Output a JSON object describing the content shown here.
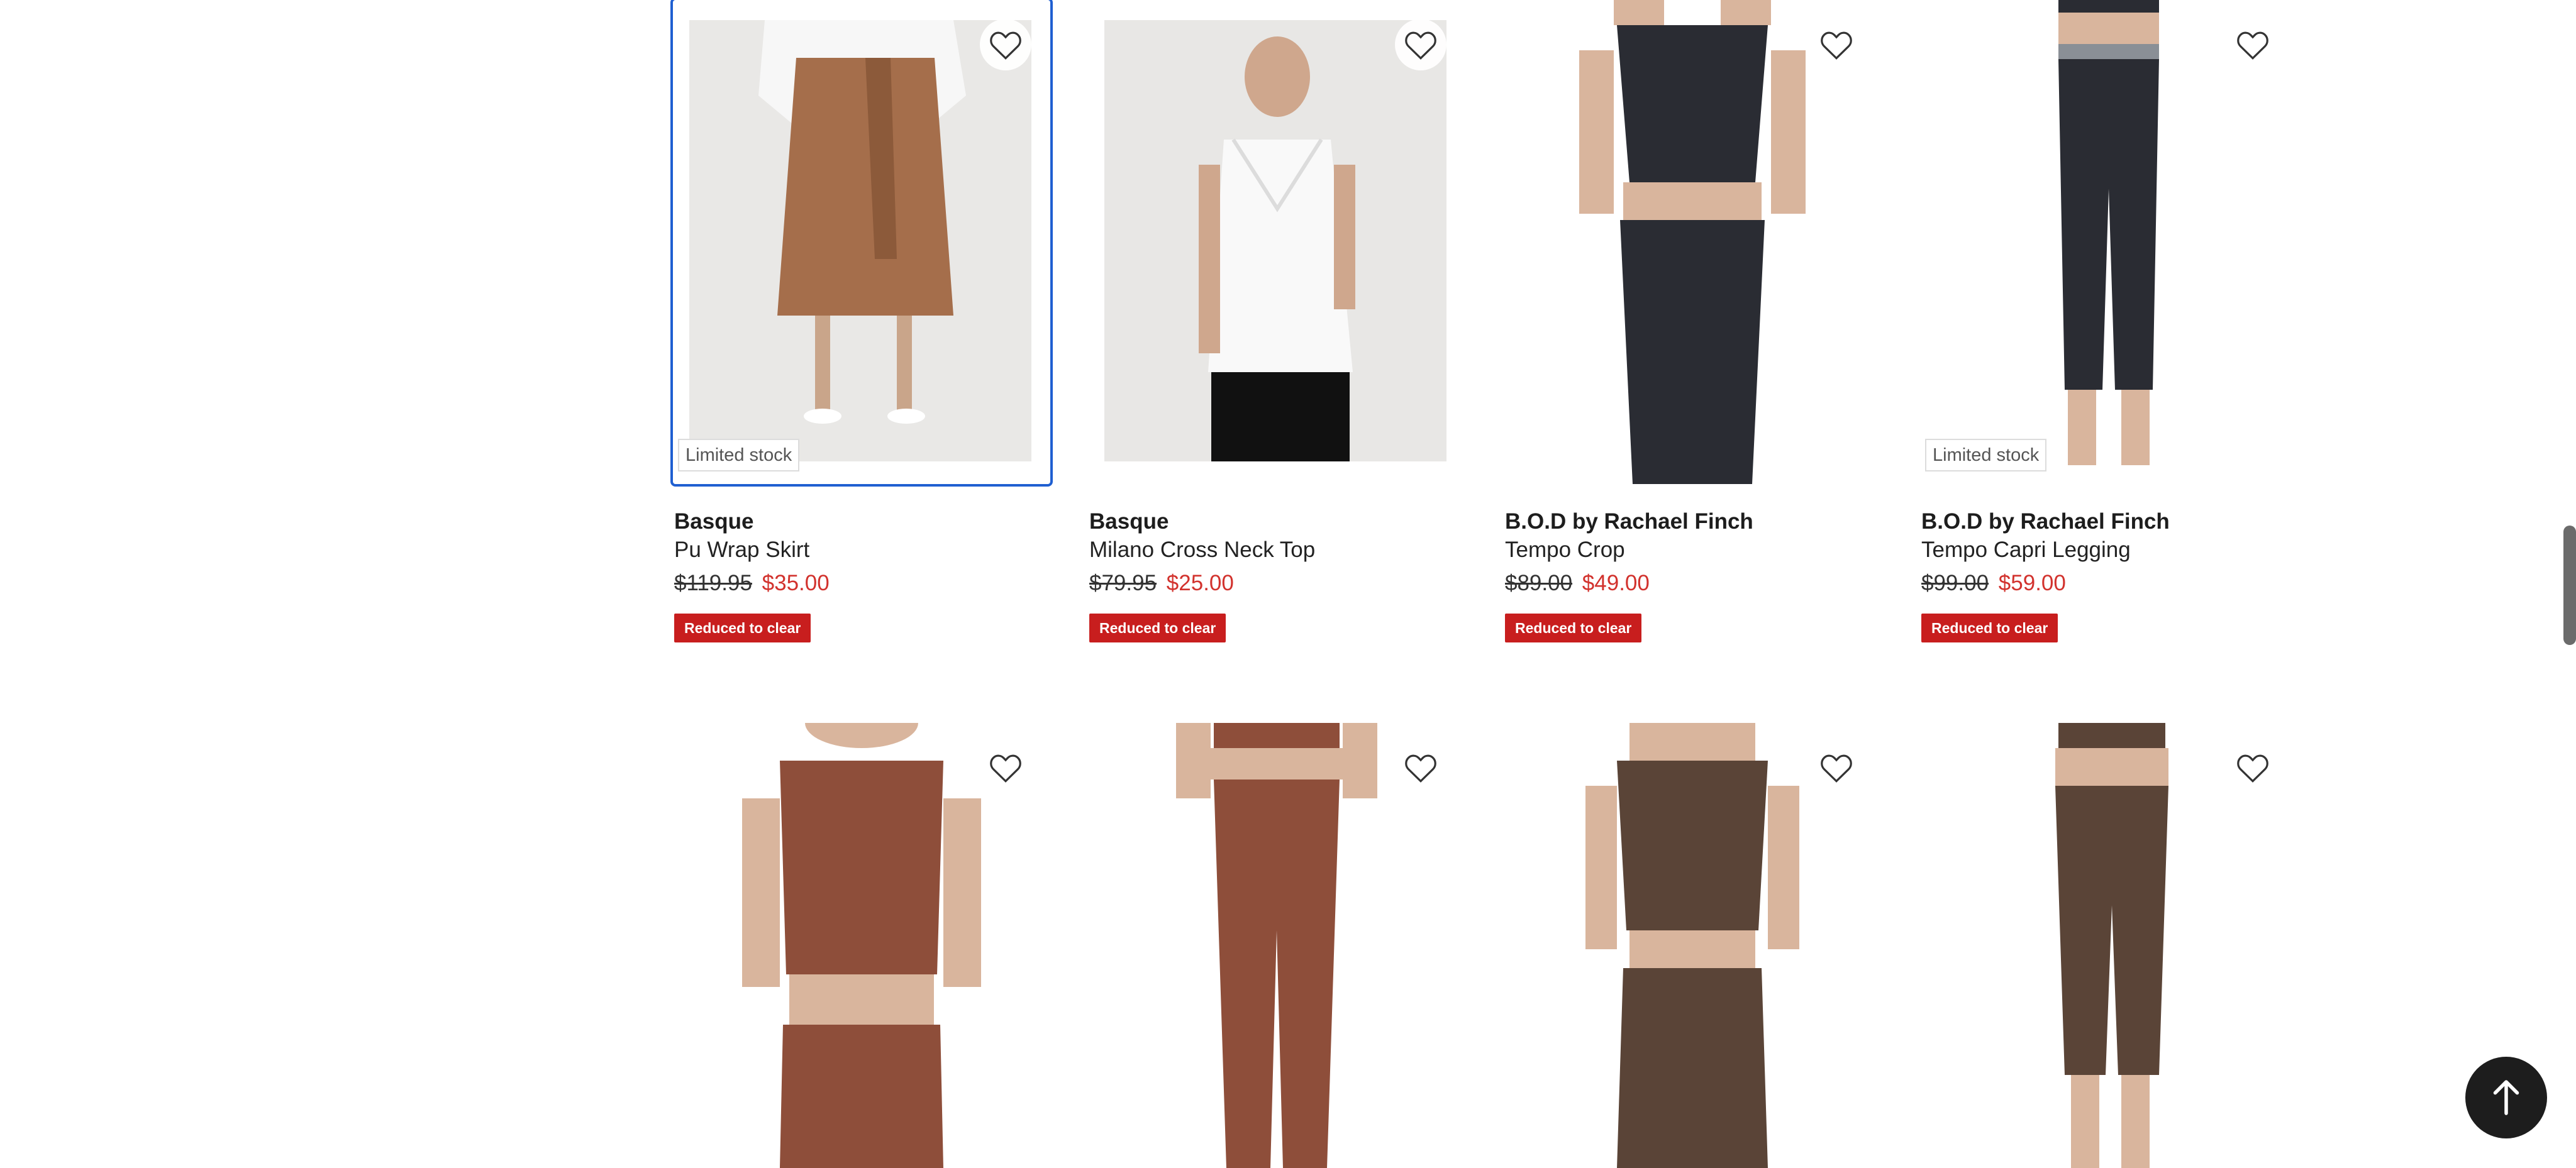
{
  "products_row1": [
    {
      "brand": "Basque",
      "name": "Pu Wrap Skirt",
      "was": "$119.95",
      "now": "$35.00",
      "badge": "Limited stock",
      "tag": "Reduced to clear"
    },
    {
      "brand": "Basque",
      "name": "Milano Cross Neck Top",
      "was": "$79.95",
      "now": "$25.00",
      "badge": "",
      "tag": "Reduced to clear"
    },
    {
      "brand": "B.O.D by Rachael Finch",
      "name": "Tempo Crop",
      "was": "$89.00",
      "now": "$49.00",
      "badge": "",
      "tag": "Reduced to clear"
    },
    {
      "brand": "B.O.D by Rachael Finch",
      "name": "Tempo Capri Legging",
      "was": "$99.00",
      "now": "$59.00",
      "badge": "Limited stock",
      "tag": "Reduced to clear"
    }
  ],
  "icons": {
    "favourite": "heart-outline-icon",
    "back_to_top": "arrow-up-icon"
  },
  "colors": {
    "sale_price": "#d2322d",
    "reduced_tag": "#c81e1e",
    "focus_outline": "#1f5fd1"
  }
}
